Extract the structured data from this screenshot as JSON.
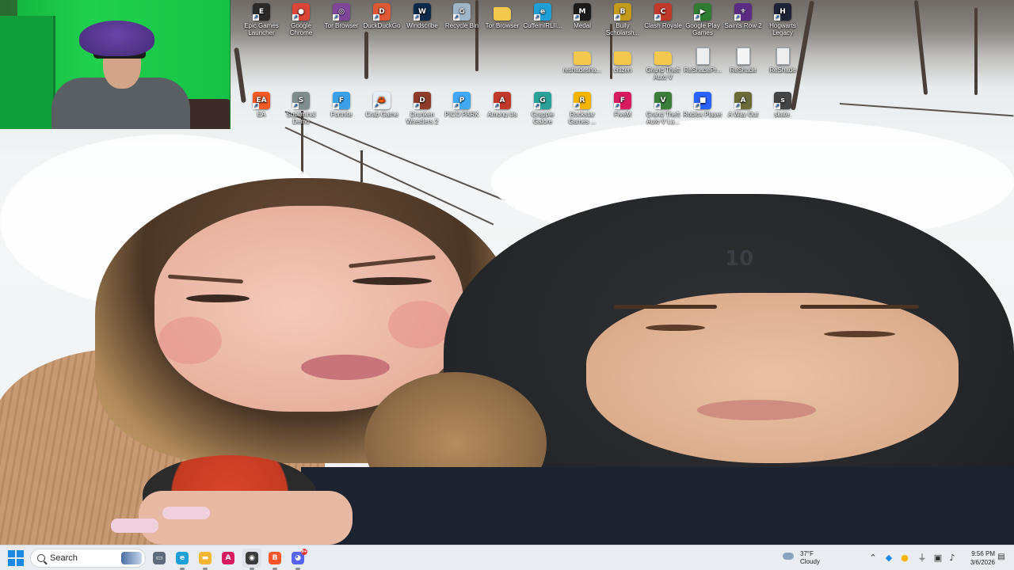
{
  "desktop": {
    "icons_row1": [
      {
        "label": "Epic Games Launcher",
        "icon": "epic-games-icon",
        "color": "#2a2a2a",
        "glyph": "E"
      },
      {
        "label": "Google Chrome",
        "icon": "chrome-icon",
        "color": "#db4437",
        "glyph": "●"
      },
      {
        "label": "Tor Browser",
        "icon": "tor-icon",
        "color": "#7d4698",
        "glyph": "◎"
      },
      {
        "label": "DuckDuckGo",
        "icon": "duckduckgo-icon",
        "color": "#de5833",
        "glyph": "D"
      },
      {
        "label": "Windscribe",
        "icon": "windscribe-icon",
        "color": "#0b2a4a",
        "glyph": "W"
      },
      {
        "label": "Recycle Bin",
        "icon": "recycle-bin-icon",
        "color": "#9fb6c8",
        "glyph": "♻"
      },
      {
        "label": "Tor Browser",
        "icon": "folder-icon",
        "color": "#f2c94c",
        "glyph": ""
      },
      {
        "label": "CuffemIRLII...",
        "icon": "edge-icon",
        "color": "#1e9fd6",
        "glyph": "e"
      },
      {
        "label": "Medal",
        "icon": "medal-icon",
        "color": "#1a1a1a",
        "glyph": "M"
      },
      {
        "label": "Bully Scholarsh...",
        "icon": "bully-icon",
        "color": "#c49a1b",
        "glyph": "B"
      },
      {
        "label": "Clash Royale",
        "icon": "clash-royale-icon",
        "color": "#c0392b",
        "glyph": "C"
      },
      {
        "label": "Google Play Games",
        "icon": "google-play-games-icon",
        "color": "#2e7d32",
        "glyph": "▶"
      },
      {
        "label": "Saints Row 2",
        "icon": "saints-row-icon",
        "color": "#5b2c83",
        "glyph": "⚜"
      },
      {
        "label": "Hogwarts Legacy",
        "icon": "hogwarts-icon",
        "color": "#1d2236",
        "glyph": "H"
      }
    ],
    "icons_row2": [
      {
        "label": "reshadesha...",
        "icon": "folder-icon",
        "color": "#f2c94c",
        "glyph": ""
      },
      {
        "label": "citizen",
        "icon": "folder-icon",
        "color": "#f2c94c",
        "glyph": ""
      },
      {
        "label": "Grand Theft Auto V",
        "icon": "folder-icon",
        "color": "#f2c94c",
        "glyph": ""
      },
      {
        "label": "ReShadePr...",
        "icon": "document-icon",
        "color": "#eeeeee",
        "glyph": ""
      },
      {
        "label": "ReShade",
        "icon": "document-icon",
        "color": "#f5f5f5",
        "glyph": ""
      },
      {
        "label": "ReShade",
        "icon": "document-icon",
        "color": "#eeeeee",
        "glyph": ""
      }
    ],
    "icons_row3": [
      {
        "label": "EA",
        "icon": "ea-icon",
        "color": "#f15a24",
        "glyph": "EA"
      },
      {
        "label": "Subliminal Demo",
        "icon": "subliminal-icon",
        "color": "#7f8c8d",
        "glyph": "S"
      },
      {
        "label": "Fortnite",
        "icon": "fortnite-icon",
        "color": "#3aa0e8",
        "glyph": "F"
      },
      {
        "label": "Crab Game",
        "icon": "crab-game-icon",
        "color": "#e8eef5",
        "glyph": "🦀"
      },
      {
        "label": "Drunken Wrestlers 2",
        "icon": "drunken-wrestlers-icon",
        "color": "#8e3b2b",
        "glyph": "D"
      },
      {
        "label": "PICO PARK",
        "icon": "pico-park-icon",
        "color": "#3fa9f5",
        "glyph": "P"
      },
      {
        "label": "Among Us",
        "icon": "among-us-icon",
        "color": "#c0392b",
        "glyph": "A"
      },
      {
        "label": "Grapple Galore",
        "icon": "grapple-galore-icon",
        "color": "#2aa198",
        "glyph": "G"
      },
      {
        "label": "Rockstar Games ...",
        "icon": "rockstar-icon",
        "color": "#f7b500",
        "glyph": "R"
      },
      {
        "label": "FiveM",
        "icon": "fivem-icon",
        "color": "#d81b60",
        "glyph": "F"
      },
      {
        "label": "Grand Theft Auto V La...",
        "icon": "gta-v-icon",
        "color": "#3c7d3c",
        "glyph": "V"
      },
      {
        "label": "Roblox Player",
        "icon": "roblox-icon",
        "color": "#2962ff",
        "glyph": "■"
      },
      {
        "label": "A Way Out",
        "icon": "a-way-out-icon",
        "color": "#6b6b3a",
        "glyph": "A"
      },
      {
        "label": "skate.",
        "icon": "skate-icon",
        "color": "#444444",
        "glyph": "s"
      }
    ]
  },
  "wallpaper": {
    "hat_logo": "10"
  },
  "taskbar": {
    "search_placeholder": "Search",
    "apps": [
      {
        "name": "taskview-icon",
        "glyph": "▭",
        "color": "#5f6b7a"
      },
      {
        "name": "edge-icon",
        "glyph": "e",
        "color": "#1e9fd6"
      },
      {
        "name": "file-explorer-icon",
        "glyph": "▬",
        "color": "#f2b632"
      },
      {
        "name": "adobe-icon",
        "glyph": "A",
        "color": "#d81b60"
      },
      {
        "name": "obs-icon",
        "glyph": "◉",
        "color": "#3b3b3b"
      },
      {
        "name": "brave-icon",
        "glyph": "B",
        "color": "#fb542b"
      },
      {
        "name": "discord-icon",
        "glyph": "◕",
        "color": "#5865f2"
      }
    ],
    "discord_badge": "9+",
    "weather": {
      "temp": "37°F",
      "condition": "Cloudy"
    },
    "clock": {
      "time": "9:56 PM",
      "date": "3/6/2026"
    }
  }
}
